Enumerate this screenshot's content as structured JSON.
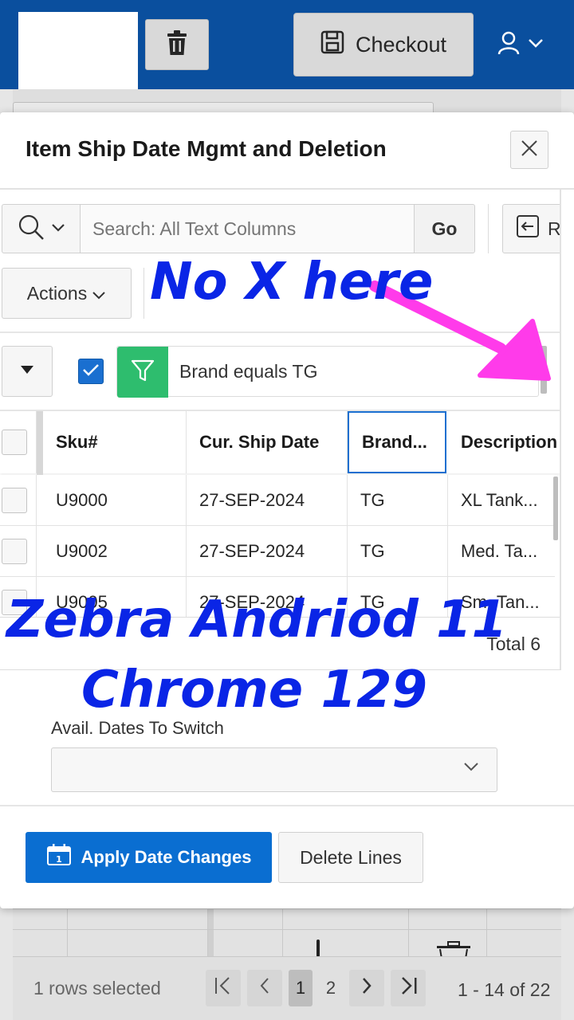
{
  "header": {
    "checkout_label": "Checkout",
    "brand_color": "#0a4f9e"
  },
  "background_page": {
    "rows_selected": "1 rows selected",
    "pages": [
      "1",
      "2"
    ],
    "range_text": "1 - 14 of 22"
  },
  "modal": {
    "title": "Item Ship Date Mgmt and Deletion",
    "toolbar": {
      "search_placeholder": "Search: All Text Columns",
      "go_label": "Go",
      "reset_label": "R",
      "actions_label": "Actions"
    },
    "filter": {
      "checked": true,
      "text": "Brand equals TG",
      "color": "#2ebd6e"
    },
    "grid": {
      "columns": [
        "Sku#",
        "Cur. Ship Date",
        "Brand...",
        "Description"
      ],
      "rows": [
        [
          "U9000",
          "27-SEP-2024",
          "TG",
          "XL Tank..."
        ],
        [
          "U9002",
          "27-SEP-2024",
          "TG",
          "Med. Ta..."
        ],
        [
          "U9005",
          "27-SEP-2024",
          "TG",
          "Sm. Tan..."
        ]
      ],
      "total": "Total 6"
    },
    "date_field": {
      "label": "Avail. Dates To Switch",
      "value": ""
    },
    "buttons": {
      "apply": "Apply Date Changes",
      "delete": "Delete Lines",
      "primary_color": "#0a6ed1"
    }
  },
  "annotations": {
    "note_top": "No X here",
    "note_device": "Zebra Andriod 11",
    "note_browser": "Chrome 129",
    "text_color": "#0a25e6",
    "arrow_color": "#ff3bea"
  }
}
